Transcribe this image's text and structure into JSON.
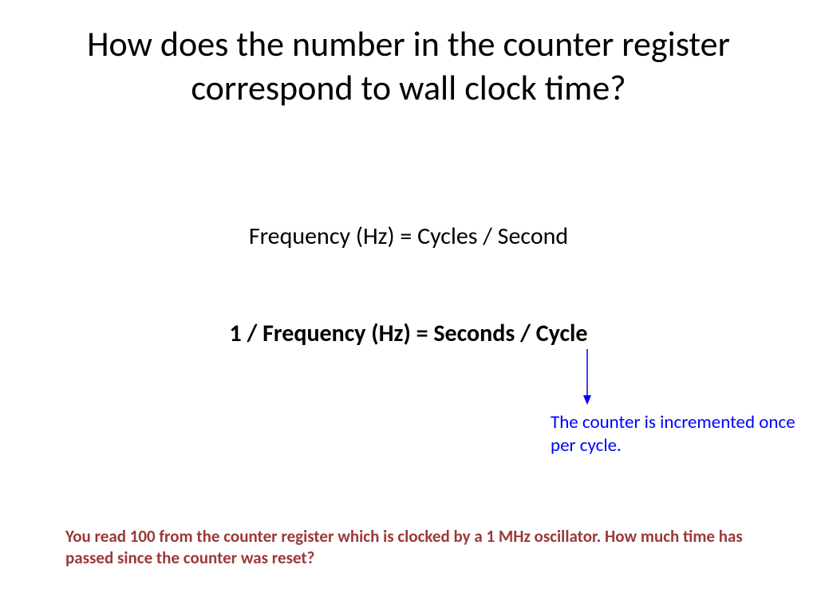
{
  "title": "How does the number in the counter register correspond to wall clock time?",
  "equation1": "Frequency (Hz) = Cycles / Second",
  "equation2": "1 / Frequency (Hz) = Seconds / Cycle",
  "annotation": "The counter is incremented once per cycle.",
  "question": "You read 100 from the counter register which is clocked by a 1 MHz oscillator. How much time has passed since the counter was reset?",
  "colors": {
    "annotation": "#0000ff",
    "question": "#9b3939"
  }
}
